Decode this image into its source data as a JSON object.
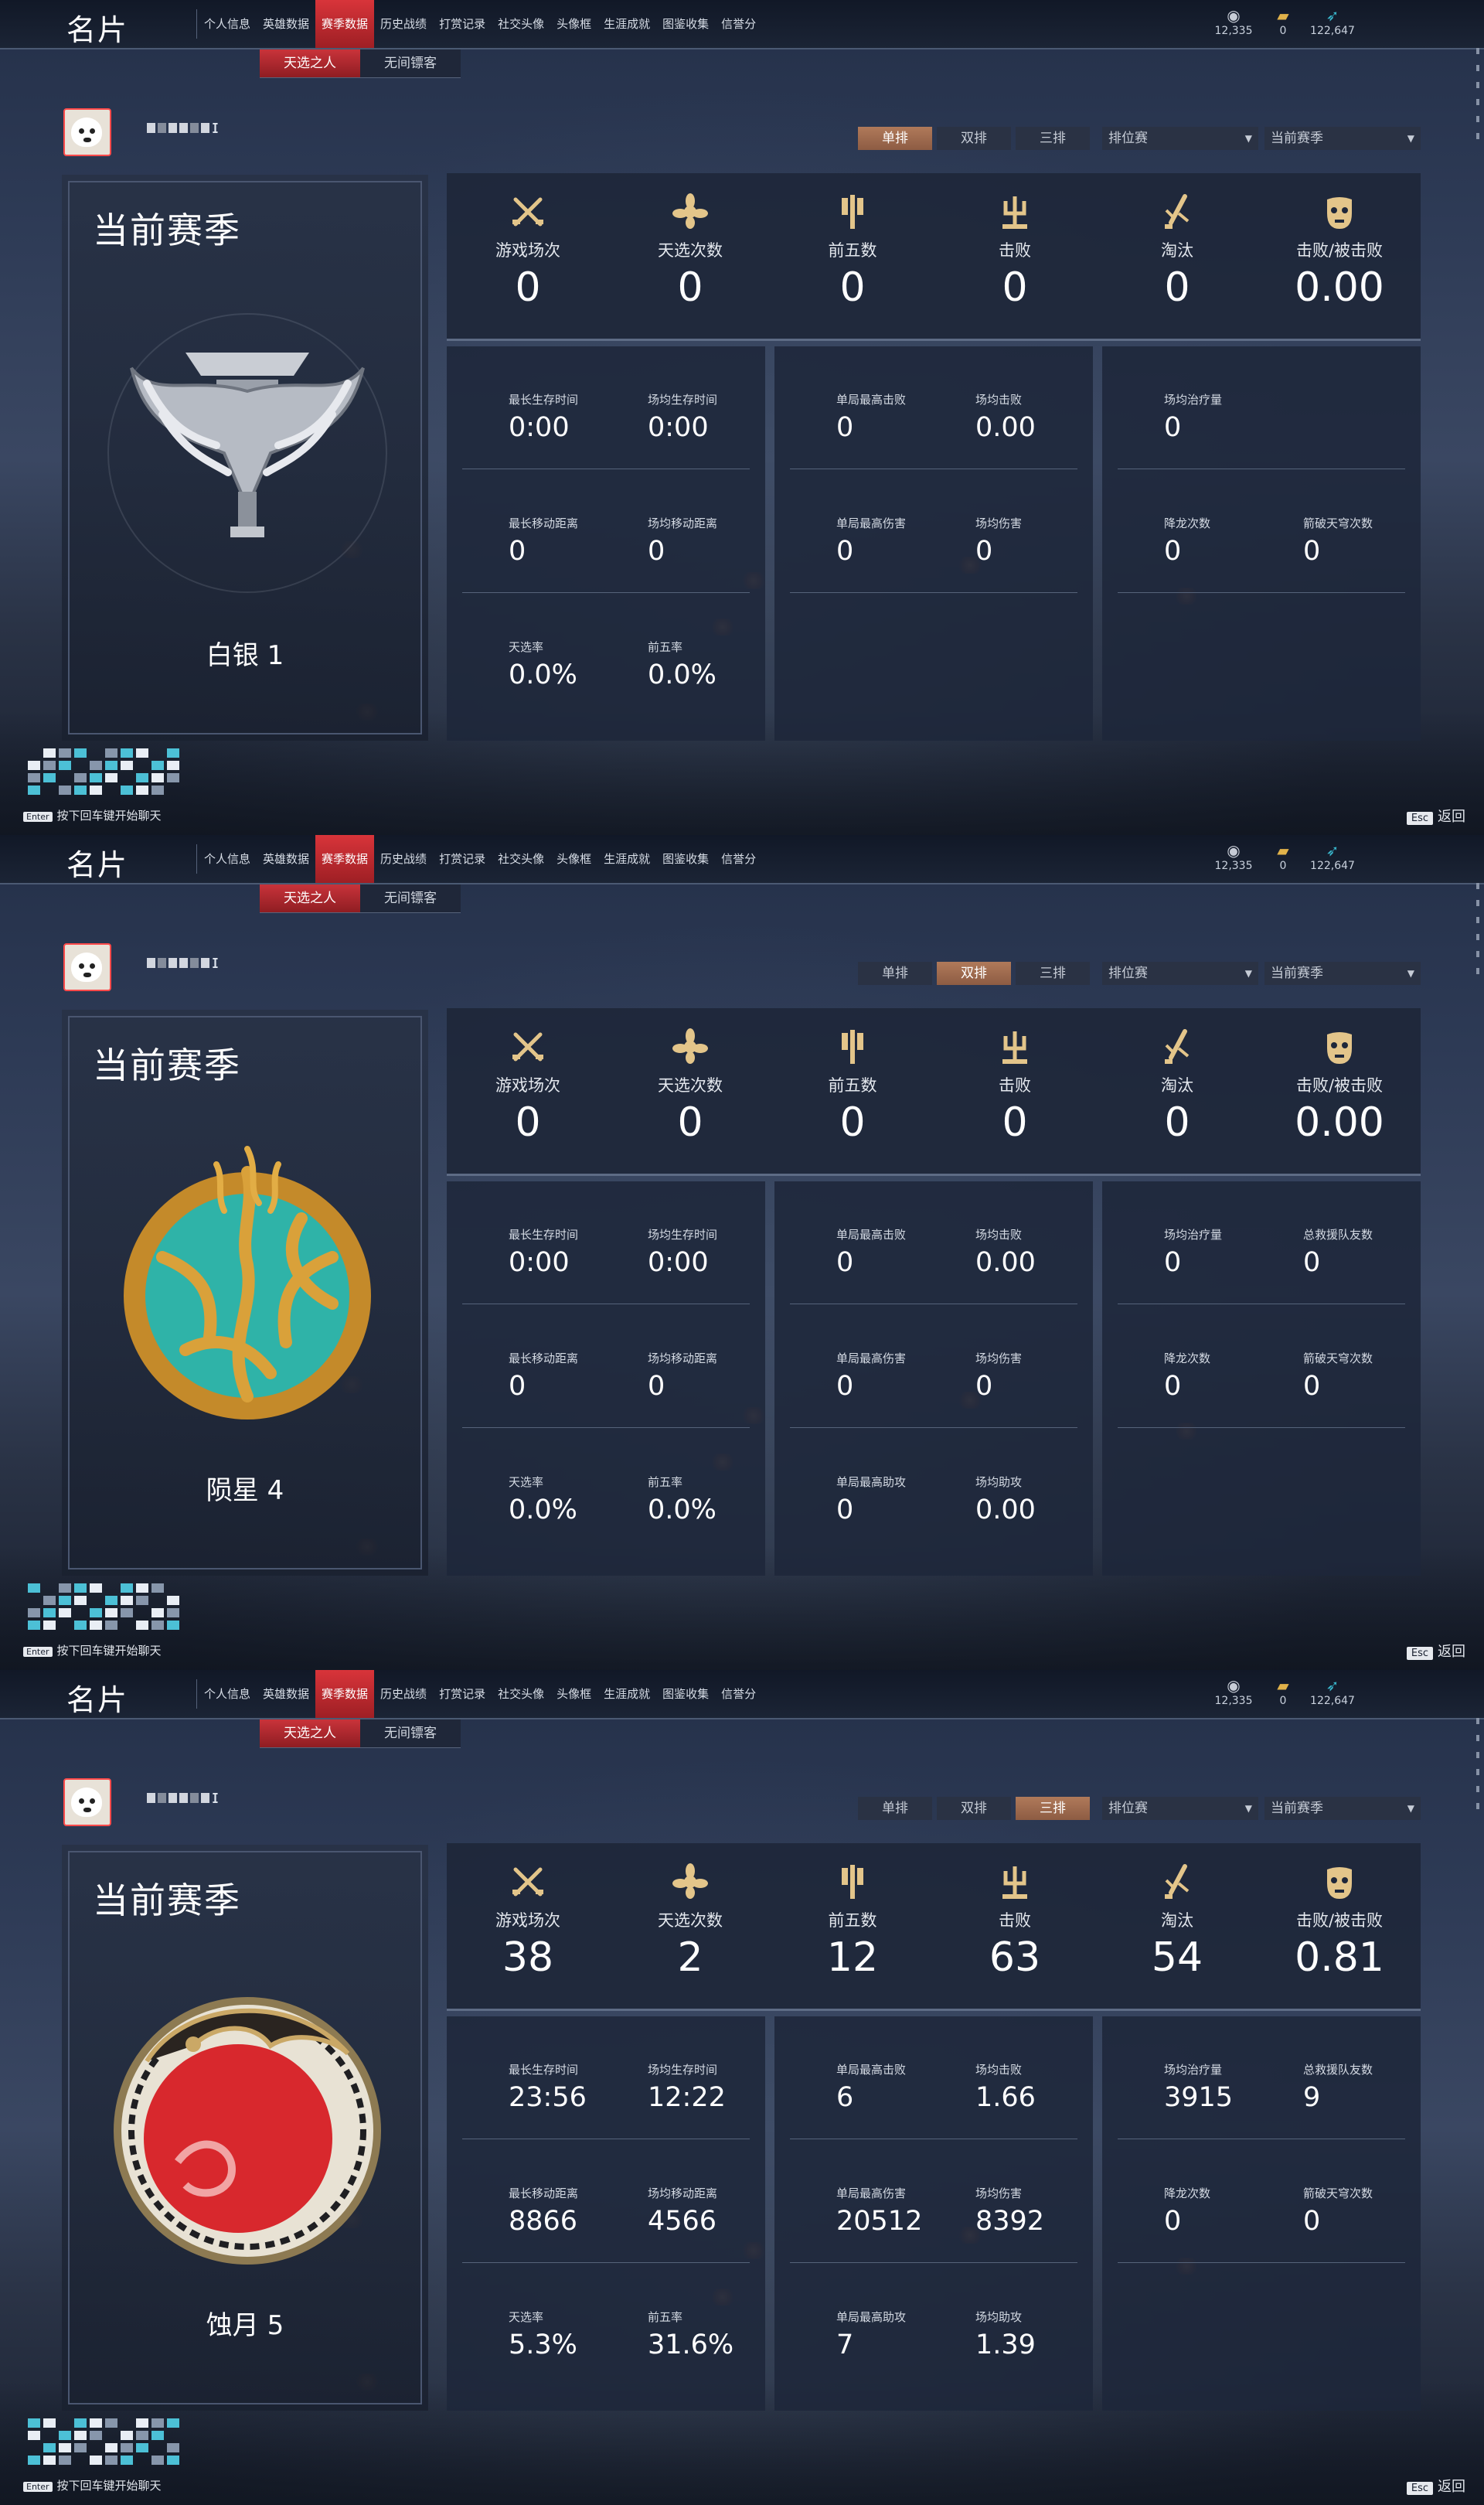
{
  "nav": {
    "title": "名片",
    "items": [
      "个人信息",
      "英雄数据",
      "赛季数据",
      "历史战绩",
      "打赏记录",
      "社交头像",
      "头像框",
      "生涯成就",
      "图鉴收集",
      "信誉分"
    ],
    "active_index": 2,
    "subtabs": [
      "天选之人",
      "无间镖客"
    ],
    "active_subtab": 0
  },
  "currency": [
    {
      "icon": "coin-icon",
      "value": "12,335"
    },
    {
      "icon": "ticket-icon",
      "value": "0"
    },
    {
      "icon": "feather-icon",
      "value": "122,647"
    }
  ],
  "user": {
    "name_glyph": "ɪ"
  },
  "modes": [
    "单排",
    "双排",
    "三排"
  ],
  "dropdowns": {
    "type": "排位赛",
    "season": "当前赛季"
  },
  "chat": {
    "enter_key": "Enter",
    "hint": "按下回车键开始聊天"
  },
  "esc": {
    "key": "Esc",
    "label": "返回"
  },
  "top_labels": [
    "游戏场次",
    "天选次数",
    "前五数",
    "击败",
    "淘汰",
    "击败/被击败"
  ],
  "panels": [
    {
      "active_mode": 0,
      "season_title": "当前赛季",
      "rank_name": "白银 1",
      "rank_color": "#b9bdc4",
      "top_values": [
        "0",
        "0",
        "0",
        "0",
        "0",
        "0.00"
      ],
      "box1": [
        {
          "label": "最长生存时间",
          "value": "0:00"
        },
        {
          "label": "场均生存时间",
          "value": "0:00"
        },
        {
          "label": "最长移动距离",
          "value": "0"
        },
        {
          "label": "场均移动距离",
          "value": "0"
        },
        {
          "label": "天选率",
          "value": "0.0%"
        },
        {
          "label": "前五率",
          "value": "0.0%"
        }
      ],
      "box2": [
        {
          "label": "单局最高击败",
          "value": "0"
        },
        {
          "label": "场均击败",
          "value": "0.00"
        },
        {
          "label": "单局最高伤害",
          "value": "0"
        },
        {
          "label": "场均伤害",
          "value": "0"
        }
      ],
      "box3": [
        {
          "label": "场均治疗量",
          "value": "0"
        },
        {
          "label": "降龙次数",
          "value": "0"
        },
        {
          "label": "箭破天穹次数",
          "value": "0"
        }
      ]
    },
    {
      "active_mode": 1,
      "season_title": "当前赛季",
      "rank_name": "陨星 4",
      "rank_color": "#2fb3a8",
      "top_values": [
        "0",
        "0",
        "0",
        "0",
        "0",
        "0.00"
      ],
      "box1": [
        {
          "label": "最长生存时间",
          "value": "0:00"
        },
        {
          "label": "场均生存时间",
          "value": "0:00"
        },
        {
          "label": "最长移动距离",
          "value": "0"
        },
        {
          "label": "场均移动距离",
          "value": "0"
        },
        {
          "label": "天选率",
          "value": "0.0%"
        },
        {
          "label": "前五率",
          "value": "0.0%"
        }
      ],
      "box2": [
        {
          "label": "单局最高击败",
          "value": "0"
        },
        {
          "label": "场均击败",
          "value": "0.00"
        },
        {
          "label": "单局最高伤害",
          "value": "0"
        },
        {
          "label": "场均伤害",
          "value": "0"
        },
        {
          "label": "单局最高助攻",
          "value": "0"
        },
        {
          "label": "场均助攻",
          "value": "0.00"
        }
      ],
      "box3": [
        {
          "label": "场均治疗量",
          "value": "0"
        },
        {
          "label": "总救援队友数",
          "value": "0"
        },
        {
          "label": "降龙次数",
          "value": "0"
        },
        {
          "label": "箭破天穹次数",
          "value": "0"
        }
      ]
    },
    {
      "active_mode": 2,
      "season_title": "当前赛季",
      "rank_name": "蚀月 5",
      "rank_color": "#d8282d",
      "top_values": [
        "38",
        "2",
        "12",
        "63",
        "54",
        "0.81"
      ],
      "box1": [
        {
          "label": "最长生存时间",
          "value": "23:56"
        },
        {
          "label": "场均生存时间",
          "value": "12:22"
        },
        {
          "label": "最长移动距离",
          "value": "8866"
        },
        {
          "label": "场均移动距离",
          "value": "4566"
        },
        {
          "label": "天选率",
          "value": "5.3%"
        },
        {
          "label": "前五率",
          "value": "31.6%"
        }
      ],
      "box2": [
        {
          "label": "单局最高击败",
          "value": "6"
        },
        {
          "label": "场均击败",
          "value": "1.66"
        },
        {
          "label": "单局最高伤害",
          "value": "20512"
        },
        {
          "label": "场均伤害",
          "value": "8392"
        },
        {
          "label": "单局最高助攻",
          "value": "7"
        },
        {
          "label": "场均助攻",
          "value": "1.39"
        }
      ],
      "box3": [
        {
          "label": "场均治疗量",
          "value": "3915"
        },
        {
          "label": "总救援队友数",
          "value": "9"
        },
        {
          "label": "降龙次数",
          "value": "0"
        },
        {
          "label": "箭破天穹次数",
          "value": "0"
        }
      ]
    }
  ]
}
